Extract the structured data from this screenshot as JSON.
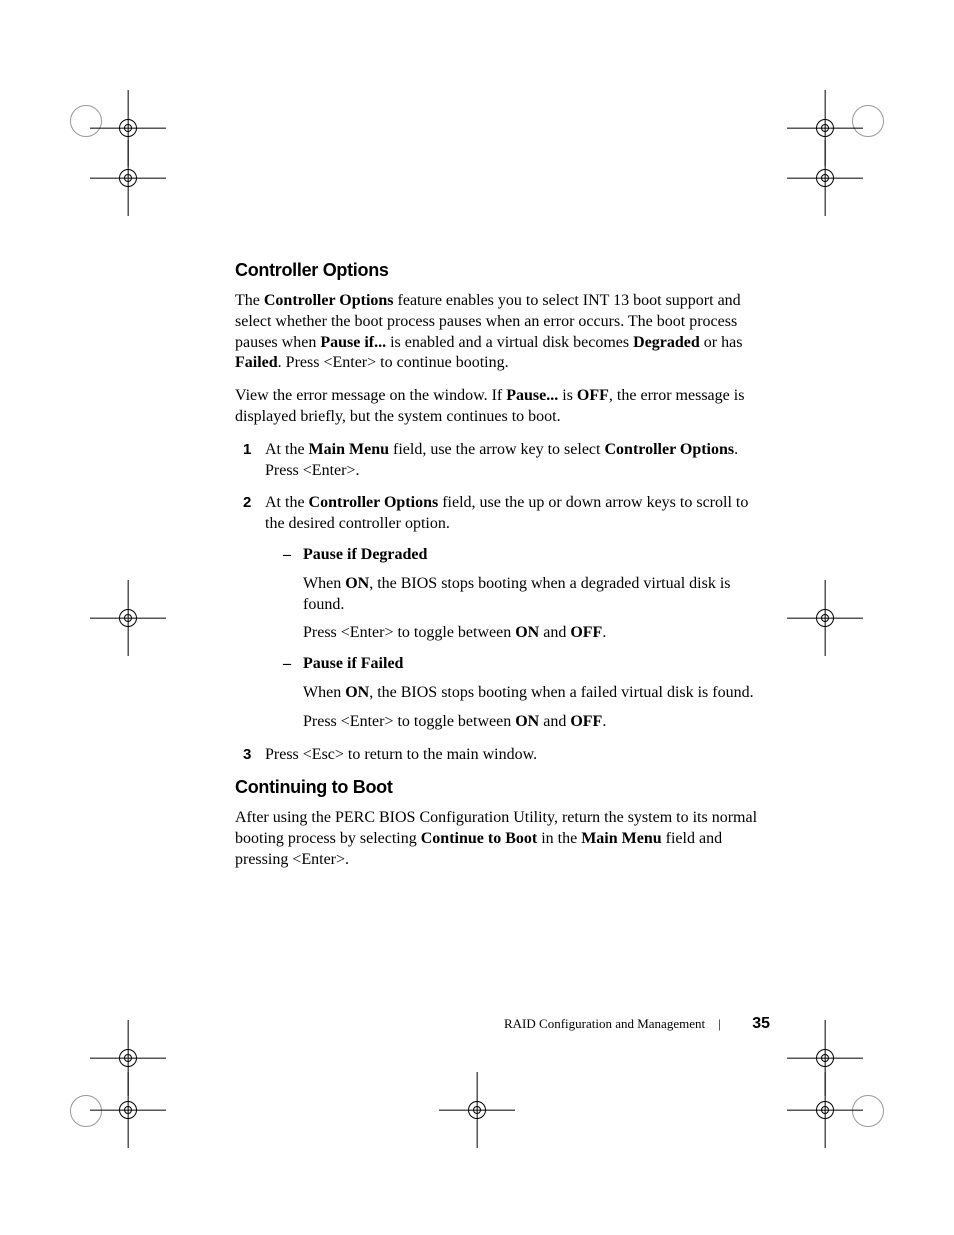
{
  "section1": {
    "heading": "Controller Options",
    "para1_pre": "The ",
    "para1_bold1": "Controller Options",
    "para1_mid1": " feature enables you to select INT 13 boot support and select whether the boot process pauses when an error occurs. The boot process pauses when ",
    "para1_bold2": "Pause if...",
    "para1_mid2": " is enabled and a virtual disk becomes ",
    "para1_bold3": "Degraded",
    "para1_mid3": " or has ",
    "para1_bold4": "Failed",
    "para1_end": ". Press <Enter> to continue booting.",
    "para2_pre": "View the error message on the window. If ",
    "para2_bold1": "Pause...",
    "para2_mid1": " is ",
    "para2_bold2": "OFF",
    "para2_end": ", the error message is displayed briefly, but the system continues to boot.",
    "list": {
      "item1": {
        "num": "1",
        "pre": "At the ",
        "bold1": "Main Menu",
        "mid1": " field, use the arrow key to select ",
        "bold2": "Controller Options",
        "end": ". Press <Enter>."
      },
      "item2": {
        "num": "2",
        "pre": "At the ",
        "bold1": "Controller Options",
        "end": " field, use the up or down arrow keys to scroll to the desired controller option.",
        "sub1": {
          "bullet": "–",
          "heading": "Pause if Degraded",
          "p1_pre": "When ",
          "p1_bold": "ON",
          "p1_end": ", the BIOS stops booting when a degraded virtual disk is found.",
          "p2_pre": "Press <Enter> to toggle between ",
          "p2_bold1": "ON",
          "p2_mid": "  and ",
          "p2_bold2": "OFF",
          "p2_end": "."
        },
        "sub2": {
          "bullet": "–",
          "heading": "Pause if Failed",
          "p1_pre": "When ",
          "p1_bold": "ON",
          "p1_end": ", the BIOS stops booting when a failed virtual disk is found.",
          "p2_pre": "Press <Enter> to toggle between ",
          "p2_bold1": "ON",
          "p2_mid": "  and ",
          "p2_bold2": "OFF",
          "p2_end": "."
        }
      },
      "item3": {
        "num": "3",
        "text": "Press <Esc> to return to the main window."
      }
    }
  },
  "section2": {
    "heading": "Continuing to Boot",
    "para_pre": "After using the PERC BIOS Configuration Utility, return the system to its normal booting process by selecting ",
    "para_bold1": "Continue to Boot",
    "para_mid1": " in the ",
    "para_bold2": "Main Menu",
    "para_end": " field and pressing <Enter>."
  },
  "footer": {
    "title": "RAID Configuration and Management",
    "divider": "|",
    "page": "35"
  }
}
